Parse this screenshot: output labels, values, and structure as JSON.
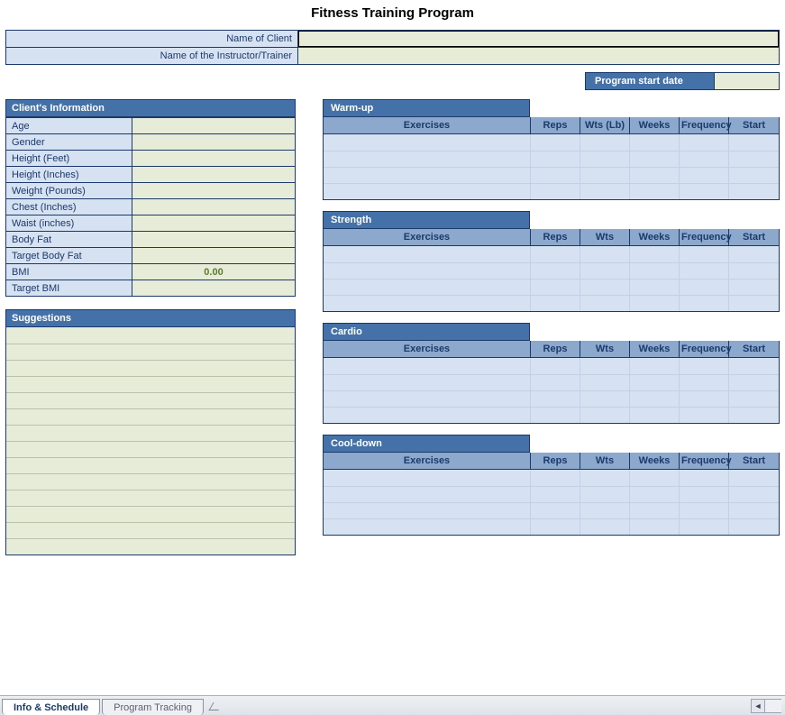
{
  "title": "Fitness Training Program",
  "header": {
    "client_label": "Name of Client",
    "client_value": "",
    "trainer_label": "Name of the Instructor/Trainer",
    "trainer_value": ""
  },
  "program_start": {
    "label": "Program start date",
    "value": ""
  },
  "client_info": {
    "title": "Client's Information",
    "rows": [
      {
        "label": "Age",
        "value": ""
      },
      {
        "label": "Gender",
        "value": ""
      },
      {
        "label": "Height (Feet)",
        "value": ""
      },
      {
        "label": "Height (Inches)",
        "value": ""
      },
      {
        "label": "Weight (Pounds)",
        "value": ""
      },
      {
        "label": "Chest (Inches)",
        "value": ""
      },
      {
        "label": "Waist (inches)",
        "value": ""
      },
      {
        "label": "Body Fat",
        "value": ""
      },
      {
        "label": "Target Body Fat",
        "value": ""
      },
      {
        "label": "BMI",
        "value": "0.00"
      },
      {
        "label": "Target BMI",
        "value": ""
      }
    ]
  },
  "suggestions": {
    "title": "Suggestions",
    "row_count": 14
  },
  "exercise_sections": [
    {
      "title": "Warm-up",
      "cols": [
        "Exercises",
        "Reps",
        "Wts (Lb)",
        "Weeks",
        "Frequency",
        "Start"
      ],
      "row_count": 4
    },
    {
      "title": "Strength",
      "cols": [
        "Exercises",
        "Reps",
        "Wts",
        "Weeks",
        "Frequency",
        "Start"
      ],
      "row_count": 4
    },
    {
      "title": "Cardio",
      "cols": [
        "Exercises",
        "Reps",
        "Wts",
        "Weeks",
        "Frequency",
        "Start"
      ],
      "row_count": 4
    },
    {
      "title": "Cool-down",
      "cols": [
        "Exercises",
        "Reps",
        "Wts",
        "Weeks",
        "Frequency",
        "Start"
      ],
      "row_count": 4
    }
  ],
  "tabs": {
    "active": "Info & Schedule",
    "other": "Program Tracking"
  }
}
